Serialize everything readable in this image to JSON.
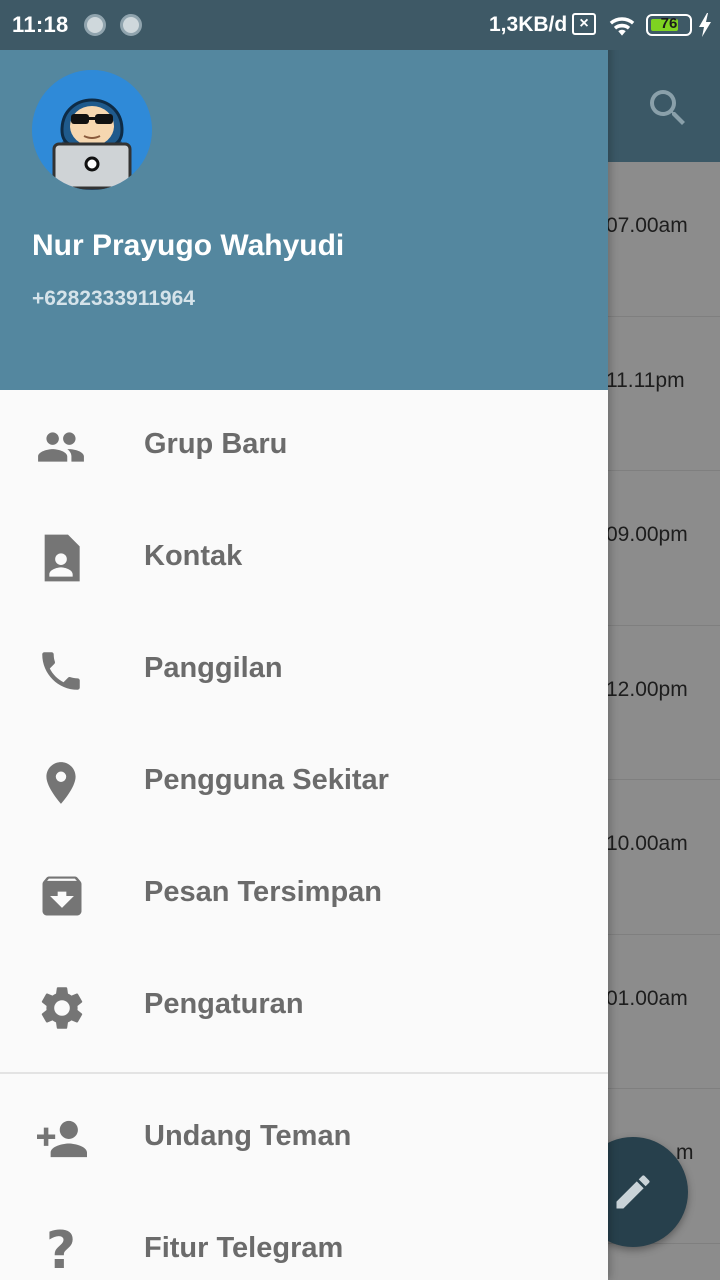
{
  "status_bar": {
    "time": "11:18",
    "net_speed": "1,3KB/d",
    "sim_icon": "x-box-icon",
    "battery_level": 76,
    "battery_text": "76",
    "battery_color": "#7ed321"
  },
  "drawer": {
    "user_name": "Nur Prayugo Wahyudi",
    "user_phone": "+6282333911964",
    "header_color": "#54879f",
    "menu_items": [
      {
        "icon": "group-icon",
        "label": "Grup Baru"
      },
      {
        "icon": "contact-icon",
        "label": "Kontak"
      },
      {
        "icon": "phone-icon",
        "label": "Panggilan"
      },
      {
        "icon": "location-pin-icon",
        "label": "Pengguna Sekitar"
      },
      {
        "icon": "archive-icon",
        "label": "Pesan Tersimpan"
      },
      {
        "icon": "gear-icon",
        "label": "Pengaturan"
      }
    ],
    "secondary_items": [
      {
        "icon": "add-person-icon",
        "label": "Undang Teman"
      },
      {
        "icon": "question-icon",
        "label": "Fitur Telegram"
      }
    ]
  },
  "background_list": {
    "times": [
      "07.00am",
      "11.11pm",
      "09.00pm",
      "12.00pm",
      "10.00am",
      "01.00am",
      "m"
    ]
  }
}
